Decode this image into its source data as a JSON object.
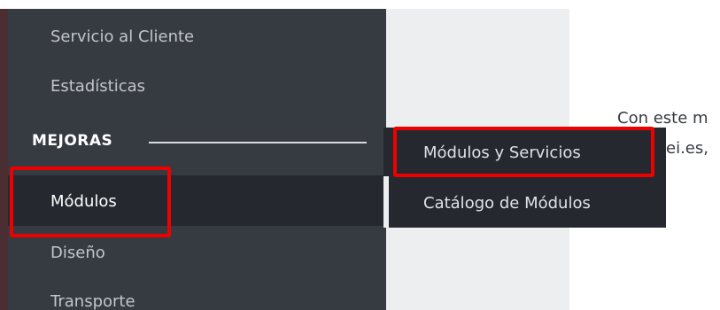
{
  "sidebar": {
    "items": [
      {
        "label": "Servicio al Cliente"
      },
      {
        "label": "Estadísticas"
      },
      {
        "label": "Módulos"
      },
      {
        "label": "Diseño"
      },
      {
        "label": "Transporte"
      }
    ],
    "section_header": "MEJORAS"
  },
  "submenu": {
    "items": [
      {
        "label": "Módulos y Servicios"
      },
      {
        "label": "Catálogo de Módulos"
      }
    ]
  },
  "content": {
    "line1": "Con este m",
    "line2": "ei.es,"
  },
  "colors": {
    "sidebar_bg": "#363a41",
    "active_bg": "#25292f",
    "highlight": "#ee0000"
  }
}
